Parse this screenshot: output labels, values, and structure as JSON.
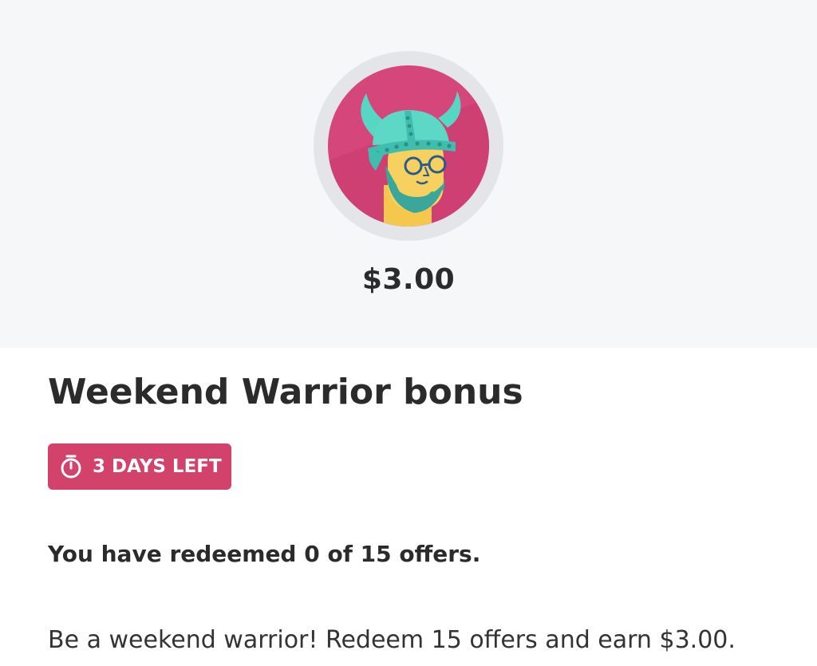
{
  "bonus": {
    "amount": "$3.00",
    "title": "Weekend Warrior bonus",
    "time_left": "3 DAYS LEFT",
    "progress_text": "You have redeemed 0 of 15 offers.",
    "redeemed": 0,
    "required": 15,
    "description": "Be a weekend warrior! Redeem 15 offers and earn $3.00."
  },
  "icons": {
    "avatar": "viking-avatar-icon",
    "timer": "stopwatch-icon"
  },
  "colors": {
    "hero_background": "#f6f7f9",
    "avatar_ring": "#e4e5e9",
    "avatar_background": "#d2426b",
    "badge_background": "#d2426b",
    "badge_text": "#ffffff",
    "text": "#2b2b2b"
  }
}
